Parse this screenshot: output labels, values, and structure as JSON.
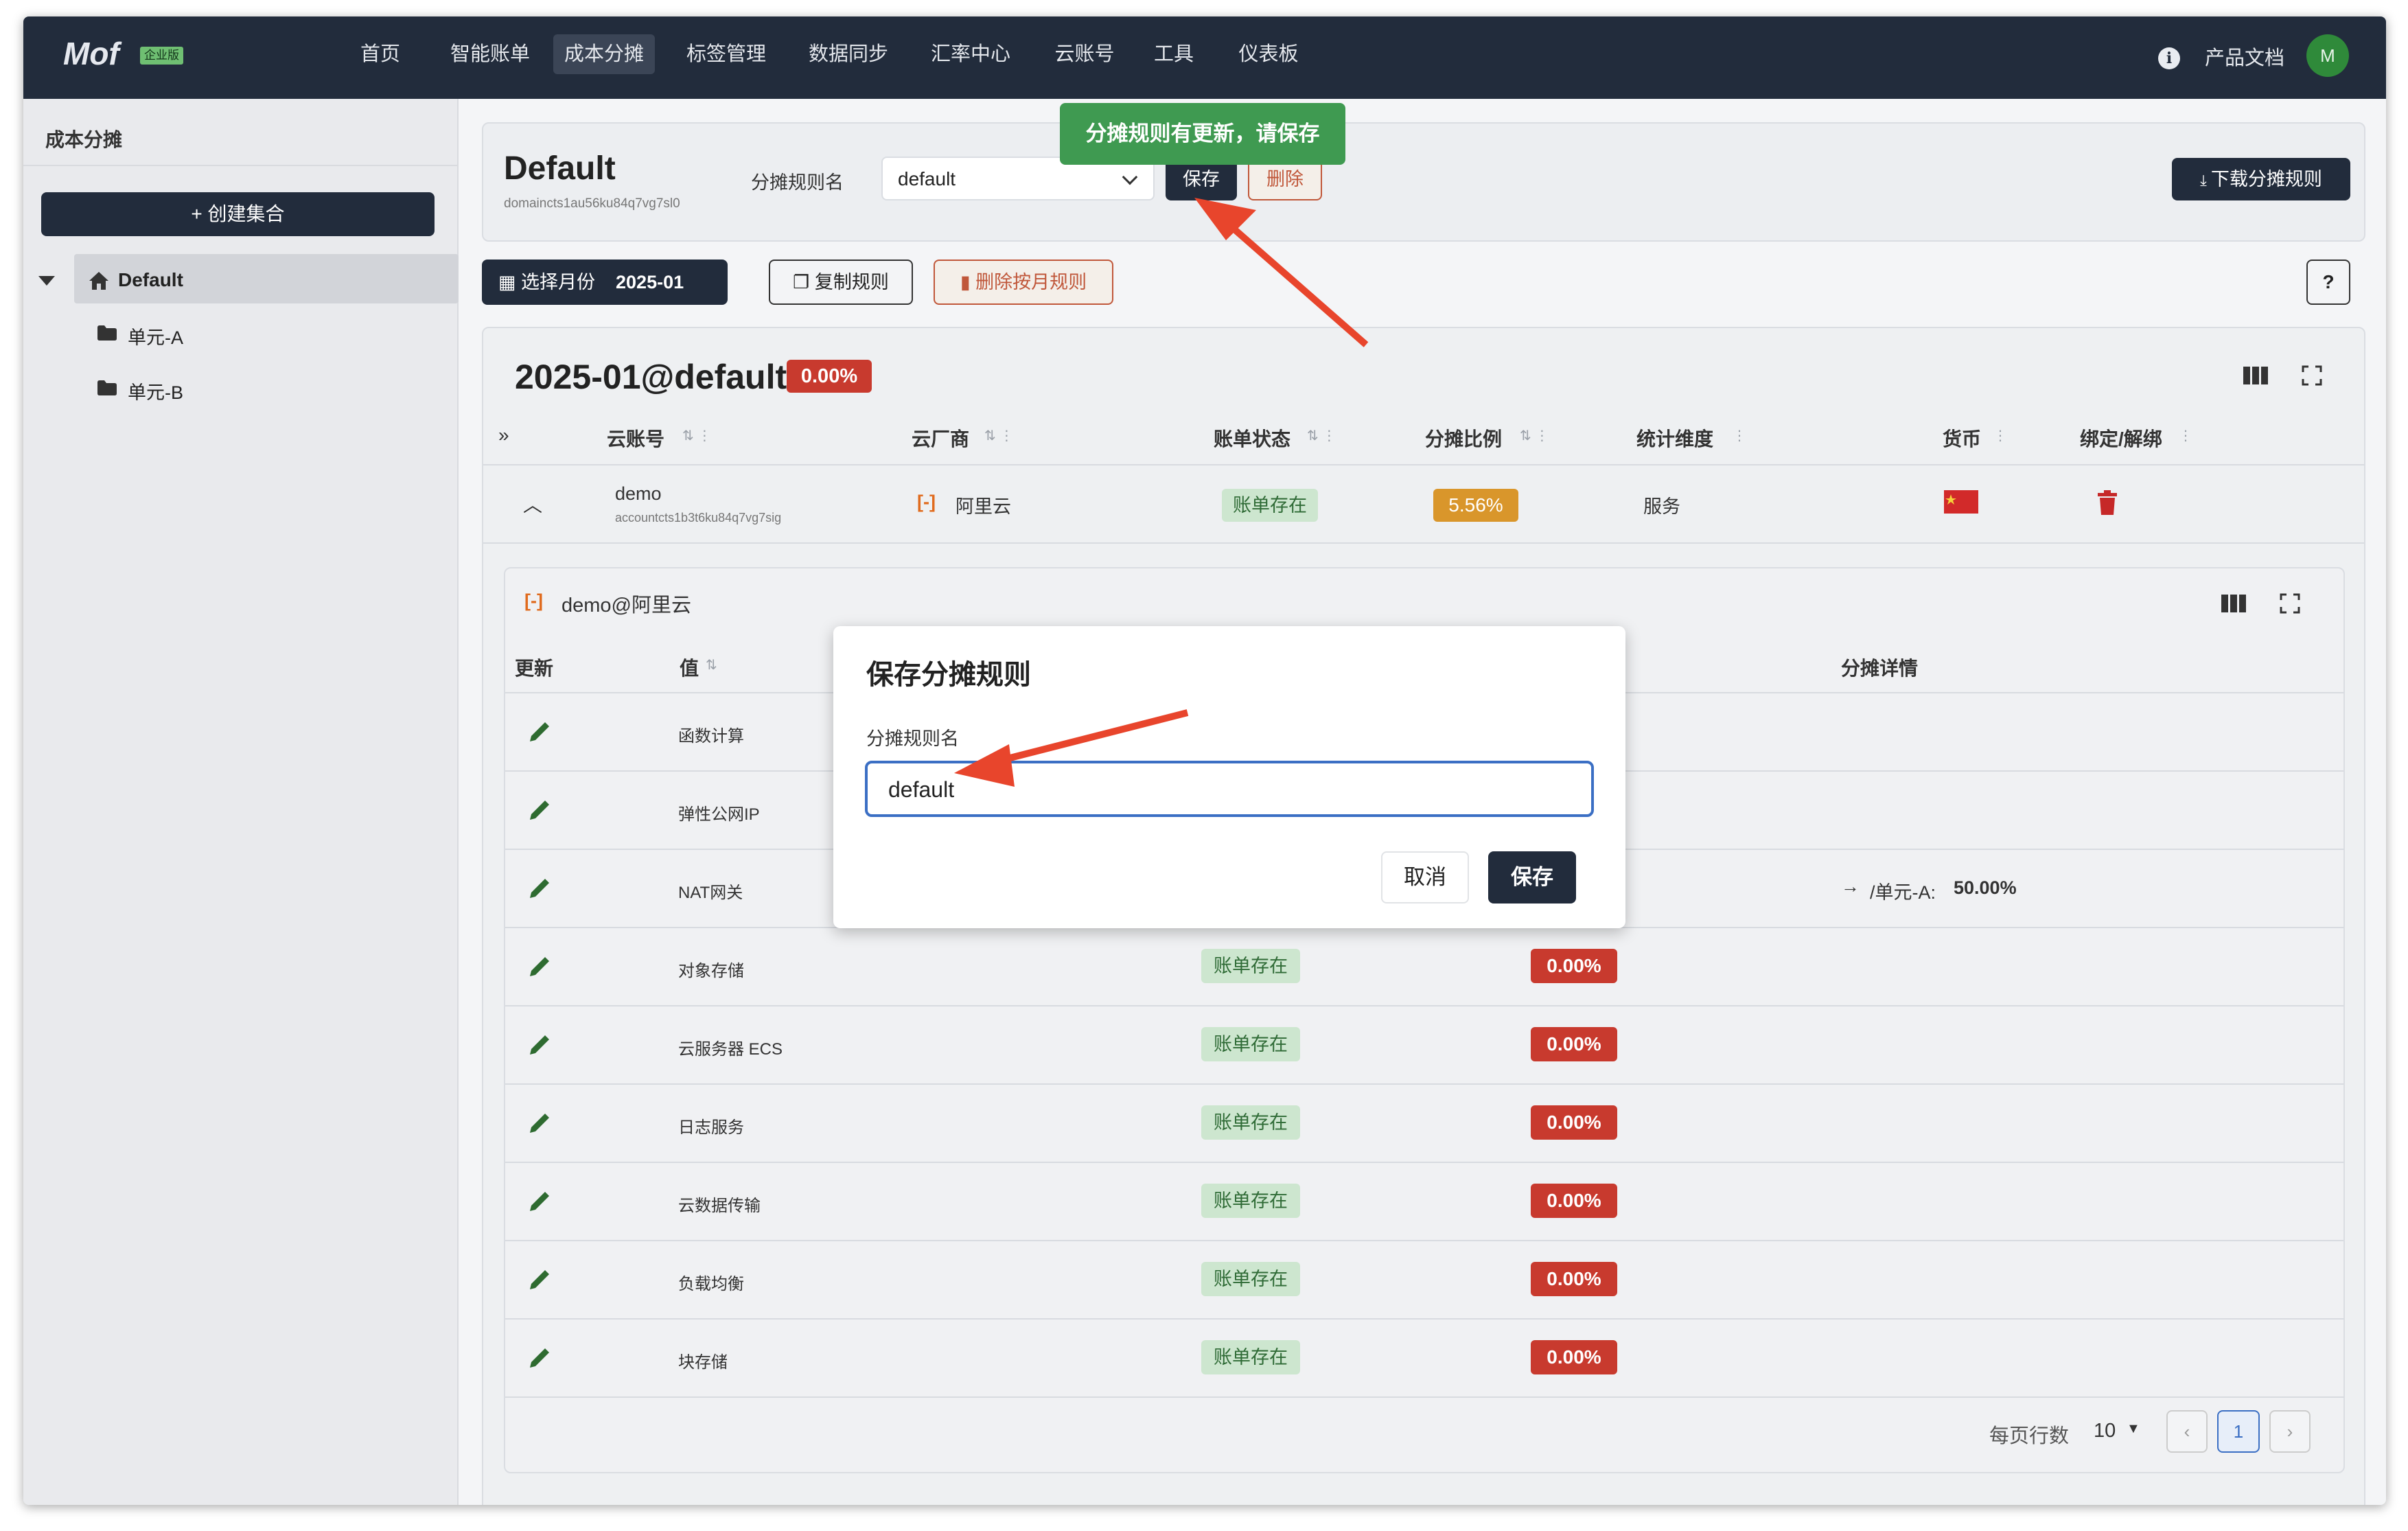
{
  "app": {
    "logo": "Mof",
    "edition_badge": "企业版"
  },
  "nav": [
    "首页",
    "智能账单",
    "成本分摊",
    "标签管理",
    "数据同步",
    "汇率中心",
    "云账号",
    "工具",
    "仪表板"
  ],
  "top_right": {
    "docs": "产品文档",
    "avatar_initial": "M"
  },
  "sidebar": {
    "title": "成本分摊",
    "create_button": "+ 创建集合",
    "tree": [
      {
        "label": "Default"
      },
      {
        "label": "单元-A"
      },
      {
        "label": "单元-B"
      }
    ]
  },
  "header": {
    "title": "Default",
    "id": "domaincts1au56ku84q7vg7sl0",
    "rule_name_label": "分摊规则名",
    "rule_name_value": "default",
    "save": "保存",
    "delete": "删除",
    "download": "下载分摊规则"
  },
  "toast": "分摊规则有更新，请保存",
  "toolbar": {
    "select_month": "选择月份",
    "month": "2025-01",
    "copy_rules": "复制规则",
    "delete_month_rules": "删除按月规则"
  },
  "period": {
    "title": "2025-01@default",
    "percent": "0.00%"
  },
  "table": {
    "columns": [
      "云账号",
      "云厂商",
      "账单状态",
      "分摊比例",
      "统计维度",
      "货币",
      "绑定/解绑"
    ],
    "row": {
      "account": "demo",
      "account_id": "accountcts1b3t6ku84q7vg7sig",
      "provider": "阿里云",
      "status": "账单存在",
      "ratio": "5.56%",
      "dimension": "服务"
    }
  },
  "subpanel": {
    "title": "demo@阿里云",
    "columns": {
      "update": "更新",
      "value": "值",
      "details": "分摊详情"
    },
    "rows": [
      {
        "value": "函数计算",
        "status": "",
        "ratio": ""
      },
      {
        "value": "弹性公网IP",
        "status": "",
        "ratio": ""
      },
      {
        "value": "NAT网关",
        "status": "",
        "ratio": "",
        "detail": "/单元-A:",
        "detail_pct": "50.00%"
      },
      {
        "value": "对象存储",
        "status": "账单存在",
        "ratio": "0.00%"
      },
      {
        "value": "云服务器 ECS",
        "status": "账单存在",
        "ratio": "0.00%"
      },
      {
        "value": "日志服务",
        "status": "账单存在",
        "ratio": "0.00%"
      },
      {
        "value": "云数据传输",
        "status": "账单存在",
        "ratio": "0.00%"
      },
      {
        "value": "负载均衡",
        "status": "账单存在",
        "ratio": "0.00%"
      },
      {
        "value": "块存储",
        "status": "账单存在",
        "ratio": "0.00%"
      }
    ],
    "pagination": {
      "rows_per_page_label": "每页行数",
      "rows_per_page": "10",
      "page": "1"
    }
  },
  "modal": {
    "title": "保存分摊规则",
    "label": "分摊规则名",
    "value": "default",
    "cancel": "取消",
    "save": "保存"
  }
}
